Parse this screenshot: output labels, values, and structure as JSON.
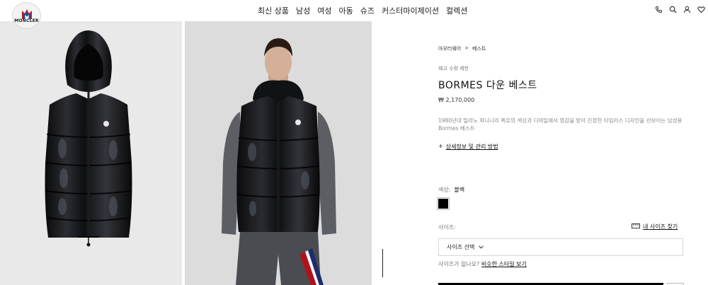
{
  "brand": {
    "logo_text": "MONCLER"
  },
  "nav": {
    "items": [
      "최신 상품",
      "남성",
      "여성",
      "아동",
      "슈즈",
      "커스터마이제이션",
      "컬렉션"
    ]
  },
  "header_icons": [
    "phone-icon",
    "search-icon",
    "user-icon",
    "heart-icon"
  ],
  "product": {
    "breadcrumb": [
      "아우터웨어",
      "베스트"
    ],
    "breadcrumb_separator": ">",
    "stock_note": "재고 수량 제한",
    "title": "BORMES 다운 베스트",
    "price": "₩ 2,170,000",
    "description": "1980년대 밀라노 파니나리 특유의 색상과 디테일에서 영감을 받아 진정한 타임리스 디자인을 선보이는 남성용 Bormes 베스트",
    "details_prefix": "+",
    "details_link": "상세정보 및 관리 방법",
    "color_label": "색상:",
    "color_value": "블랙",
    "color_swatch": "#000000",
    "size_label": "사이즈:",
    "size_guide": "내 사이즈 찾기",
    "size_select_placeholder": "사이즈 선택",
    "no_size_text": "사이즈가 없나요?",
    "no_size_link": "비슷한 스타일 보기"
  }
}
